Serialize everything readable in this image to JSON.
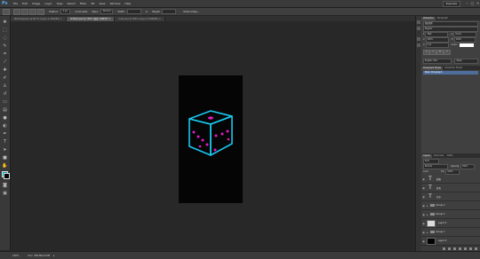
{
  "app": {
    "logo": "Ps",
    "menu": [
      "File",
      "Edit",
      "Image",
      "Layer",
      "Type",
      "Select",
      "Filter",
      "3D",
      "View",
      "Window",
      "Help"
    ],
    "workspace": "Essentials"
  },
  "options": {
    "feather_label": "Feather:",
    "feather_value": "0 px",
    "antialias_label": "Anti-alias",
    "style_label": "Style:",
    "style_value": "Normal",
    "width_label": "Width:",
    "height_label": "Height:",
    "refine_edge": "Refine Edge..."
  },
  "tabs": [
    {
      "label": "Rectangle.psd @ 66.7% (Layer 4, RGB/8#) ×"
    },
    {
      "label": "Untitled.psd @ 100% (四角, RGB/8)* ×"
    },
    {
      "label": "Cube.psd @ 100% (Layer 4, RGB/8#) ×"
    }
  ],
  "status": {
    "zoom": "100%",
    "doc": "Doc: 289.8K/9.22M"
  },
  "character": {
    "tabs": [
      "Character",
      "Paragraph"
    ],
    "font": "微软雅黑",
    "style": "Regular",
    "size": "36pt",
    "leading": "(Auto)",
    "tracking": "100%",
    "vscale": "100%",
    "baseline": "0 pt",
    "color_label": "Color:",
    "lang": "English: USA",
    "aa": "Sharp"
  },
  "paragraph_styles": {
    "tabs": [
      "Paragraph Styles",
      "Character Styles"
    ],
    "item": "Basic Paragraph"
  },
  "layers": {
    "tabs": [
      "Layers",
      "Channels",
      "Paths"
    ],
    "kind": "Kind",
    "blend": "Normal",
    "opacity_label": "Opacity:",
    "opacity": "100%",
    "lock_label": "Lock:",
    "fill_label": "Fill:",
    "fill": "100%",
    "items": [
      {
        "name": "四角",
        "kind": "text"
      },
      {
        "name": "底色",
        "kind": "text"
      },
      {
        "name": "文字",
        "kind": "text"
      },
      {
        "name": "Group 2",
        "kind": "group"
      },
      {
        "name": "Group 3",
        "kind": "group"
      },
      {
        "name": "Layer 5",
        "kind": "pixel"
      },
      {
        "name": "Group 1",
        "kind": "group"
      },
      {
        "name": "Layer 0",
        "kind": "pixel"
      }
    ]
  },
  "colors": {
    "cube_stroke": "#18c8ef",
    "dots": "#e21bc3",
    "foreground": "#00a3b8"
  }
}
